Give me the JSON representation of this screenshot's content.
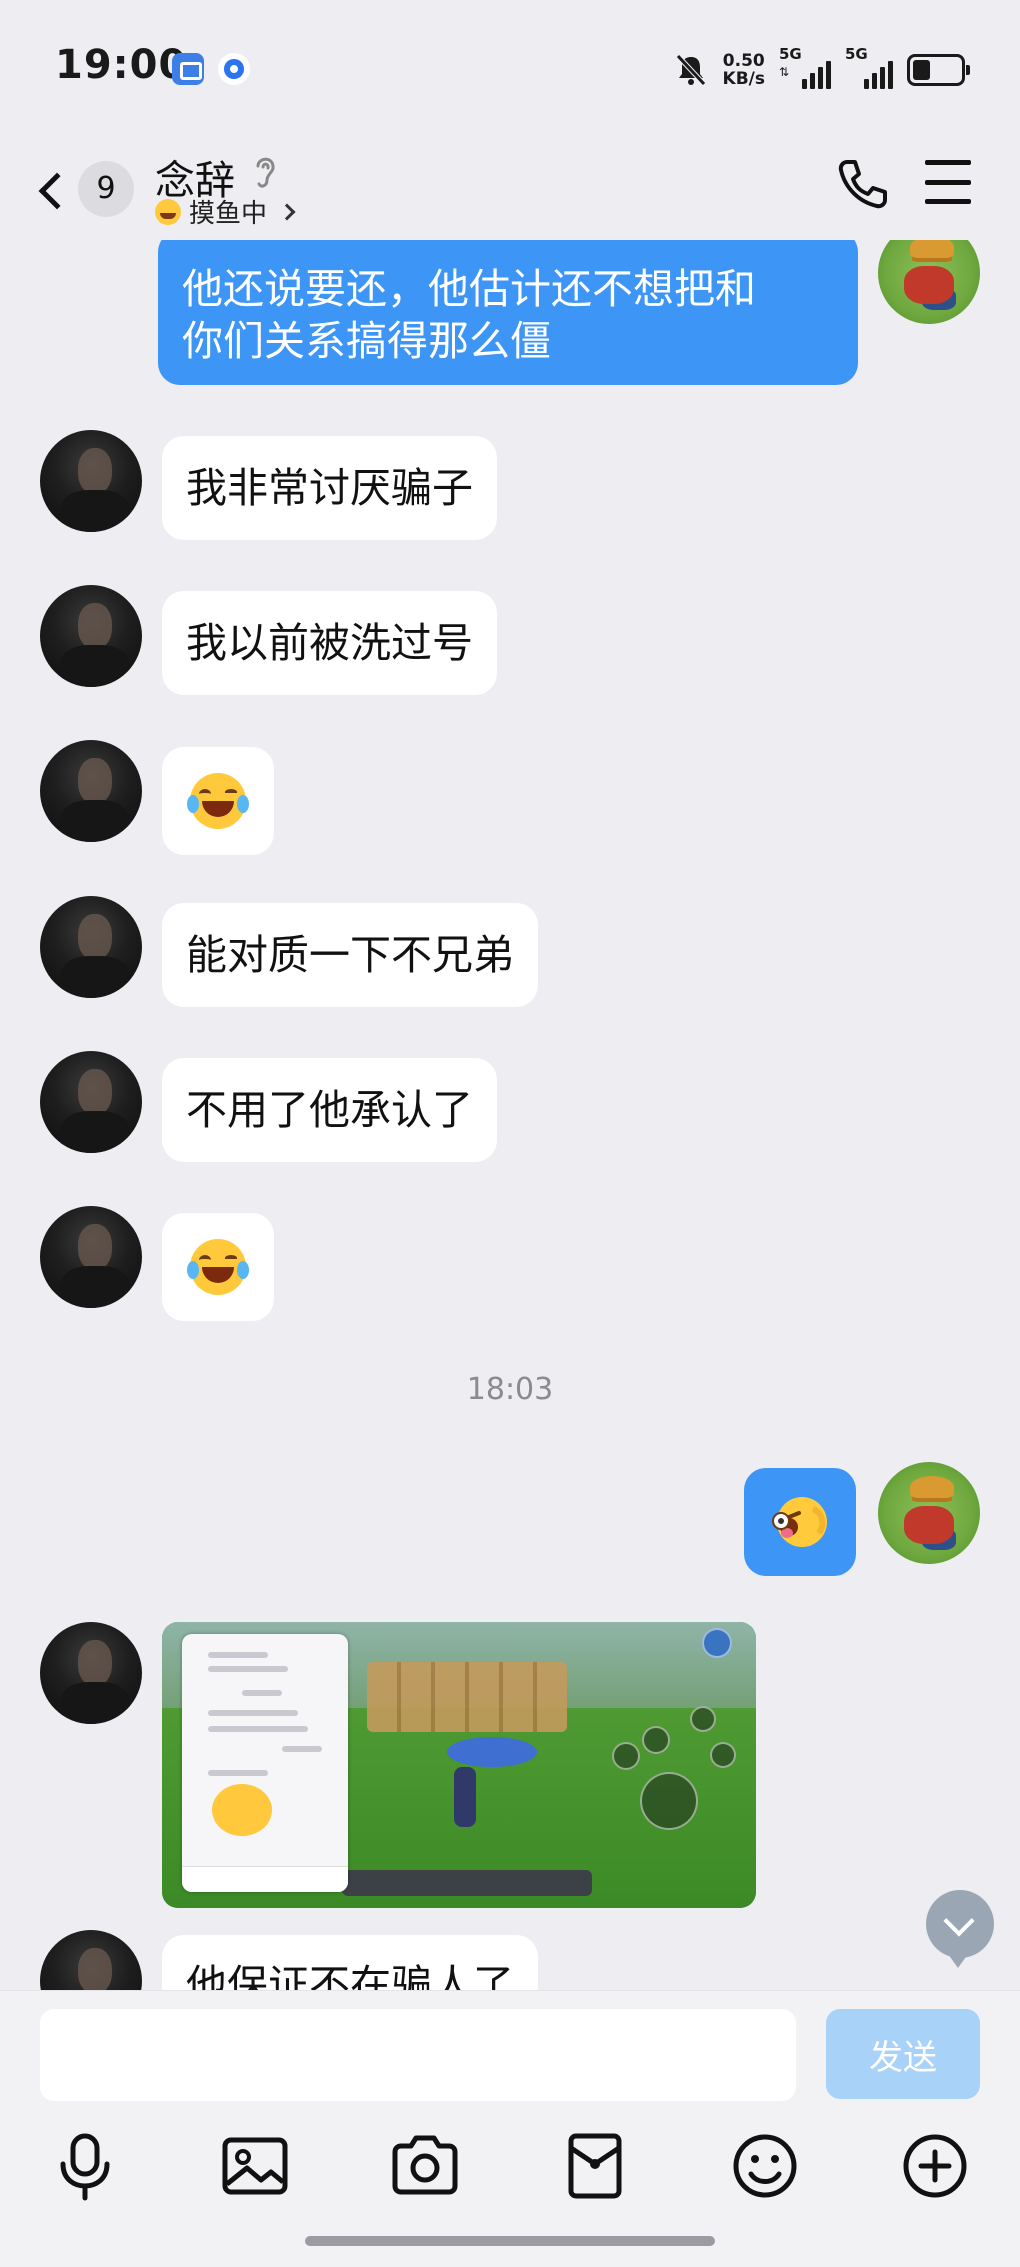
{
  "status_bar": {
    "time": "19:00",
    "net_speed_value": "0.50",
    "net_speed_unit": "KB/s",
    "sim1_label": "5G",
    "sim2_label": "5G",
    "icons": [
      "screen-mirror-icon",
      "app-notification-icon",
      "mute-bell-icon",
      "signal-icon",
      "battery-icon"
    ]
  },
  "header": {
    "unread_count": "9",
    "contact_name": "念辞",
    "status_text": "摸鱼中",
    "icons": [
      "back-chevron-icon",
      "ear-icon",
      "phone-call-icon",
      "menu-icon"
    ]
  },
  "messages": [
    {
      "sender": "self",
      "type": "text",
      "lines": [
        "他还说要还，他估计还不想把和",
        "你们关系搞得那么僵"
      ]
    },
    {
      "sender": "peer",
      "type": "text",
      "text": "我非常讨厌骗子"
    },
    {
      "sender": "peer",
      "type": "text",
      "text": "我以前被洗过号"
    },
    {
      "sender": "peer",
      "type": "emoji",
      "emoji": "laugh-cry-emoji"
    },
    {
      "sender": "peer",
      "type": "text",
      "text": "能对质一下不兄弟"
    },
    {
      "sender": "peer",
      "type": "text",
      "text": "不用了他承认了"
    },
    {
      "sender": "peer",
      "type": "emoji",
      "emoji": "laugh-cry-emoji"
    },
    {
      "sender": "self",
      "type": "emoji",
      "emoji": "tongue-wink-emoji"
    },
    {
      "sender": "peer",
      "type": "image",
      "image": "game-screenshot"
    },
    {
      "sender": "peer",
      "type": "text",
      "text": "他保证不在骗人了"
    }
  ],
  "timestamp": "18:03",
  "input": {
    "placeholder": "",
    "send_label": "发送"
  },
  "toolbar": [
    "microphone-icon",
    "image-icon",
    "camera-icon",
    "red-packet-icon",
    "emoji-icon",
    "plus-icon"
  ],
  "colors": {
    "background": "#eeeef2",
    "self_bubble": "#3d95f5",
    "peer_bubble": "#ffffff",
    "send_button_disabled": "#a9d2f8"
  }
}
